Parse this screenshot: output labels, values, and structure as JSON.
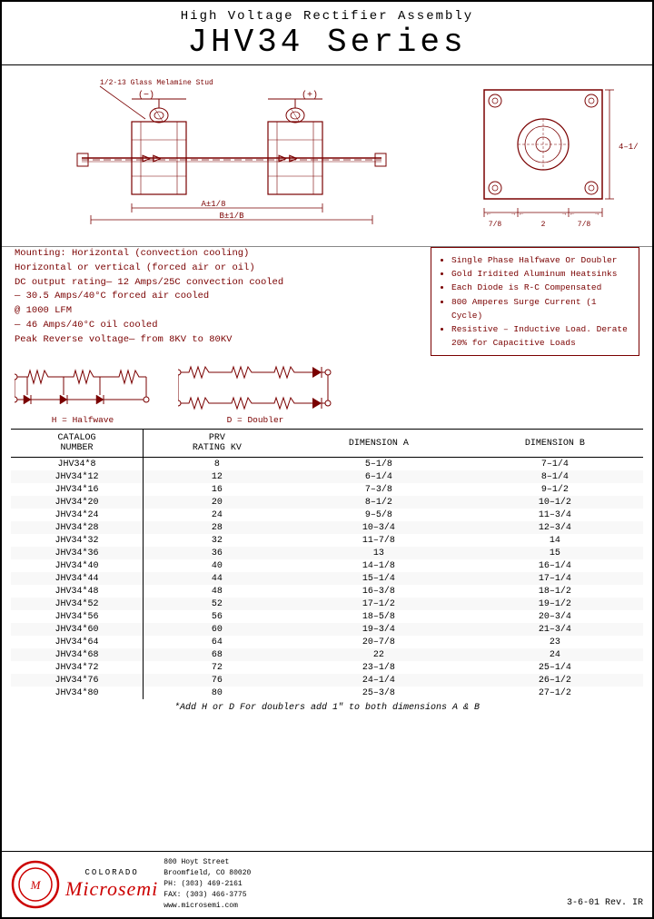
{
  "header": {
    "subtitle": "High  Voltage  Rectifier  Assembly",
    "title": "JHV34  Series"
  },
  "specs": {
    "line1": "Mounting: Horizontal (convection cooling)",
    "line2": "Horizontal or vertical (forced air or oil)",
    "line3": "DC output rating— 12 Amps/25C convection cooled",
    "line4": "— 30.5 Amps/40°C forced air cooled",
    "line5": "@ 1000 LFM",
    "line6": "— 46 Amps/40°C oil cooled",
    "line7": "Peak Reverse voltage— from 8KV to 80KV"
  },
  "bullets": [
    "Single Phase Halfwave Or Doubler",
    "Gold Iridited Aluminum Heatsinks",
    "Each Diode is R-C Compensated",
    "800 Amperes Surge Current (1 Cycle)",
    "Resistive – Inductive Load. Derate 20% for Capacitive Loads"
  ],
  "circuit_labels": [
    "H = Halfwave",
    "D = Doubler"
  ],
  "table": {
    "headers": [
      "CATALOG\nNUMBER",
      "PRV\nRATING KV",
      "DIMENSION A",
      "DIMENSION B"
    ],
    "rows": [
      [
        "JHV34*8",
        "8",
        "5–1/8",
        "7–1/4"
      ],
      [
        "JHV34*12",
        "12",
        "6–1/4",
        "8–1/4"
      ],
      [
        "JHV34*16",
        "16",
        "7–3/8",
        "9–1/2"
      ],
      [
        "JHV34*20",
        "20",
        "8–1/2",
        "10–1/2"
      ],
      [
        "JHV34*24",
        "24",
        "9–5/8",
        "11–3/4"
      ],
      [
        "JHV34*28",
        "28",
        "10–3/4",
        "12–3/4"
      ],
      [
        "JHV34*32",
        "32",
        "11–7/8",
        "14"
      ],
      [
        "JHV34*36",
        "36",
        "13",
        "15"
      ],
      [
        "JHV34*40",
        "40",
        "14–1/8",
        "16–1/4"
      ],
      [
        "JHV34*44",
        "44",
        "15–1/4",
        "17–1/4"
      ],
      [
        "JHV34*48",
        "48",
        "16–3/8",
        "18–1/2"
      ],
      [
        "JHV34*52",
        "52",
        "17–1/2",
        "19–1/2"
      ],
      [
        "JHV34*56",
        "56",
        "18–5/8",
        "20–3/4"
      ],
      [
        "JHV34*60",
        "60",
        "19–3/4",
        "21–3/4"
      ],
      [
        "JHV34*64",
        "64",
        "20–7/8",
        "23"
      ],
      [
        "JHV34*68",
        "68",
        "22",
        "24"
      ],
      [
        "JHV34*72",
        "72",
        "23–1/8",
        "25–1/4"
      ],
      [
        "JHV34*76",
        "76",
        "24–1/4",
        "26–1/2"
      ],
      [
        "JHV34*80",
        "80",
        "25–3/8",
        "27–1/2"
      ]
    ],
    "note": "*Add H or D  For doublers add 1\" to both dimensions A & B"
  },
  "footer": {
    "colorado": "COLORADO",
    "company": "Microsemi",
    "address": "800 Hoyt Street\nBroomfield, CO 80020\nPH: (303) 469-2161\nFAX: (303) 466-3775\nwww.microsemi.com",
    "rev": "3-6-01  Rev. IR"
  }
}
